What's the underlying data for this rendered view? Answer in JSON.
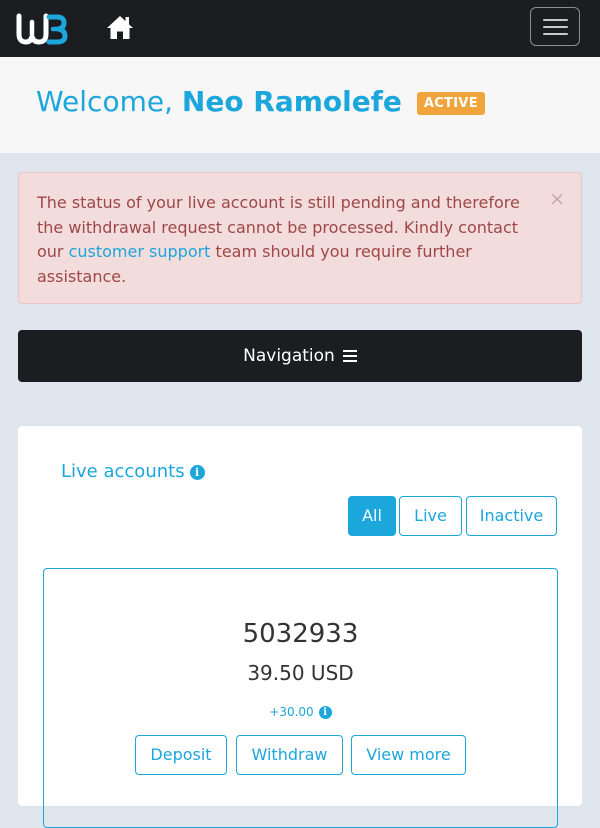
{
  "header": {
    "logo_text": "W3",
    "home_icon": "home-icon",
    "menu_icon": "hamburger-menu-icon"
  },
  "welcome": {
    "greeting": "Welcome,",
    "name": "Neo Ramolefe",
    "status": "ACTIVE"
  },
  "alert": {
    "text_before": "The status of your live account is still pending and therefore the withdrawal request cannot be processed. Kindly contact our ",
    "link": "customer support",
    "text_after": " team should you require further assistance.",
    "close": "×"
  },
  "navigation": {
    "label": "Navigation"
  },
  "accounts": {
    "title": "Live accounts",
    "info": "i",
    "filters": [
      "All",
      "Live",
      "Inactive"
    ],
    "selected_filter": "All",
    "items": [
      {
        "number": "5032933",
        "balance": "39.50 USD",
        "change": "+30.00",
        "buttons": [
          "Deposit",
          "Withdraw",
          "View more"
        ]
      }
    ]
  },
  "colors": {
    "accent": "#1ba6dc",
    "badge": "#f0a43b",
    "dark": "#1b1d20",
    "alert_bg": "#f3dcdc",
    "alert_text": "#9e4747"
  }
}
